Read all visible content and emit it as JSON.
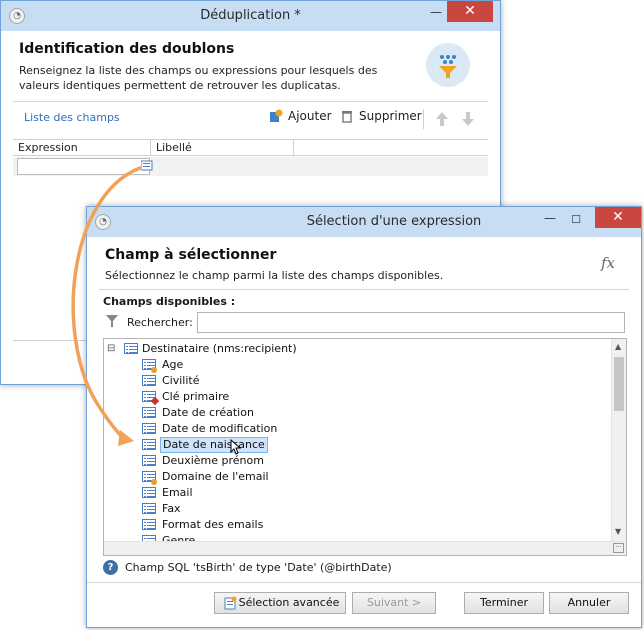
{
  "dedup": {
    "title": "Déduplication *",
    "heading": "Identification des doublons",
    "description": "Renseignez la liste des champs ou expressions pour lesquels des valeurs identiques permettent de retrouver les duplicatas.",
    "tab_label": "Liste des champs",
    "add_label": "Ajouter",
    "delete_label": "Supprimer",
    "columns": [
      "Expression",
      "Libellé"
    ]
  },
  "selection": {
    "title": "Sélection d'une expression",
    "heading": "Champ à sélectionner",
    "description": "Sélectionnez le champ parmi la liste des champs disponibles.",
    "fx_label": "fx",
    "available_label": "Champs disponibles :",
    "search_label": "Rechercher:",
    "search_value": "",
    "tree_root": "Destinataire (nms:recipient)",
    "tree_root_toggle": "⊟",
    "fields": [
      {
        "label": "Age",
        "badge": "key"
      },
      {
        "label": "Civilité",
        "badge": ""
      },
      {
        "label": "Clé primaire",
        "badge": "red"
      },
      {
        "label": "Date de création",
        "badge": ""
      },
      {
        "label": "Date de modification",
        "badge": ""
      },
      {
        "label": "Date de naissance",
        "badge": "",
        "selected": true
      },
      {
        "label": "Deuxième prénom",
        "badge": ""
      },
      {
        "label": "Domaine de l'email",
        "badge": "key"
      },
      {
        "label": "Email",
        "badge": ""
      },
      {
        "label": "Fax",
        "badge": ""
      },
      {
        "label": "Format des emails",
        "badge": ""
      },
      {
        "label": "Genre",
        "badge": ""
      }
    ],
    "status_icon": "?",
    "status_text": "Champ SQL 'tsBirth' de type 'Date' (@birthDate)",
    "buttons": {
      "advanced": "Sélection avancée",
      "next": "Suivant >",
      "finish": "Terminer",
      "cancel": "Annuler"
    }
  },
  "window_controls": {
    "minimize": "—",
    "maximize": "☐",
    "close": "✕"
  },
  "colors": {
    "accent": "#2f6fbf",
    "titlebar": "#c7ddf3",
    "close": "#c9473e",
    "arrow": "#f0a25a",
    "selection": "#cde4fb"
  }
}
